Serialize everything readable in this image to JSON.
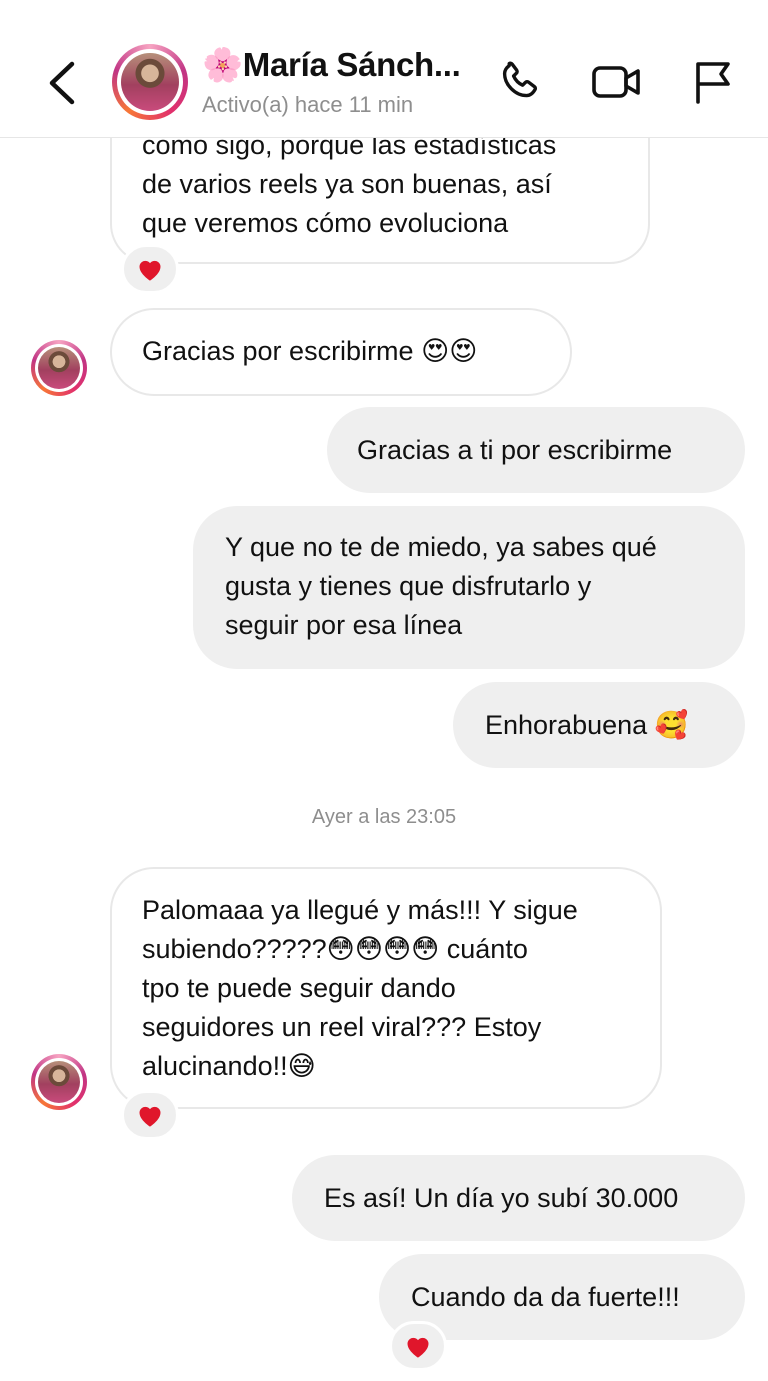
{
  "header": {
    "name": "🌸María Sánch...",
    "status": "Activo(a) hace 11 min"
  },
  "messages": [
    {
      "id": "m1",
      "direction": "incoming",
      "lines": [
        "como sigo, porque las estadísticas",
        "de varios reels ya son buenas, así",
        "que veremos cómo evoluciona"
      ],
      "reaction": "heart"
    },
    {
      "id": "m2",
      "direction": "incoming",
      "lines": [
        "Gracias por escribirme 😍😍"
      ]
    },
    {
      "id": "m3",
      "direction": "outgoing",
      "lines": [
        "Gracias a ti por escribirme"
      ]
    },
    {
      "id": "m4",
      "direction": "outgoing",
      "lines": [
        "Y que no te de miedo, ya sabes qué",
        "gusta y tienes que disfrutarlo y",
        "seguir por esa línea"
      ]
    },
    {
      "id": "m5",
      "direction": "outgoing",
      "lines": [
        "Enhorabuena 🥰"
      ]
    },
    {
      "id": "m6",
      "direction": "incoming",
      "lines": [
        "Palomaaa ya llegué y más!!! Y sigue",
        "subiendo?????😳😳😳😳 cuánto",
        "tpo te puede seguir dando",
        "seguidores  un reel  viral??? Estoy",
        "alucinando!!😅"
      ],
      "reaction": "heart"
    },
    {
      "id": "m7",
      "direction": "outgoing",
      "lines": [
        "Es así! Un día yo subí 30.000"
      ]
    },
    {
      "id": "m8",
      "direction": "outgoing",
      "lines": [
        "Cuando da da fuerte!!!"
      ],
      "reaction": "heart"
    }
  ],
  "timestamp": "Ayer a las 23:05",
  "colors": {
    "incoming_bg": "#ffffff",
    "outgoing_bg": "#efefef",
    "reaction_heart": "#e0162b",
    "muted_text": "#8e8e8e"
  }
}
